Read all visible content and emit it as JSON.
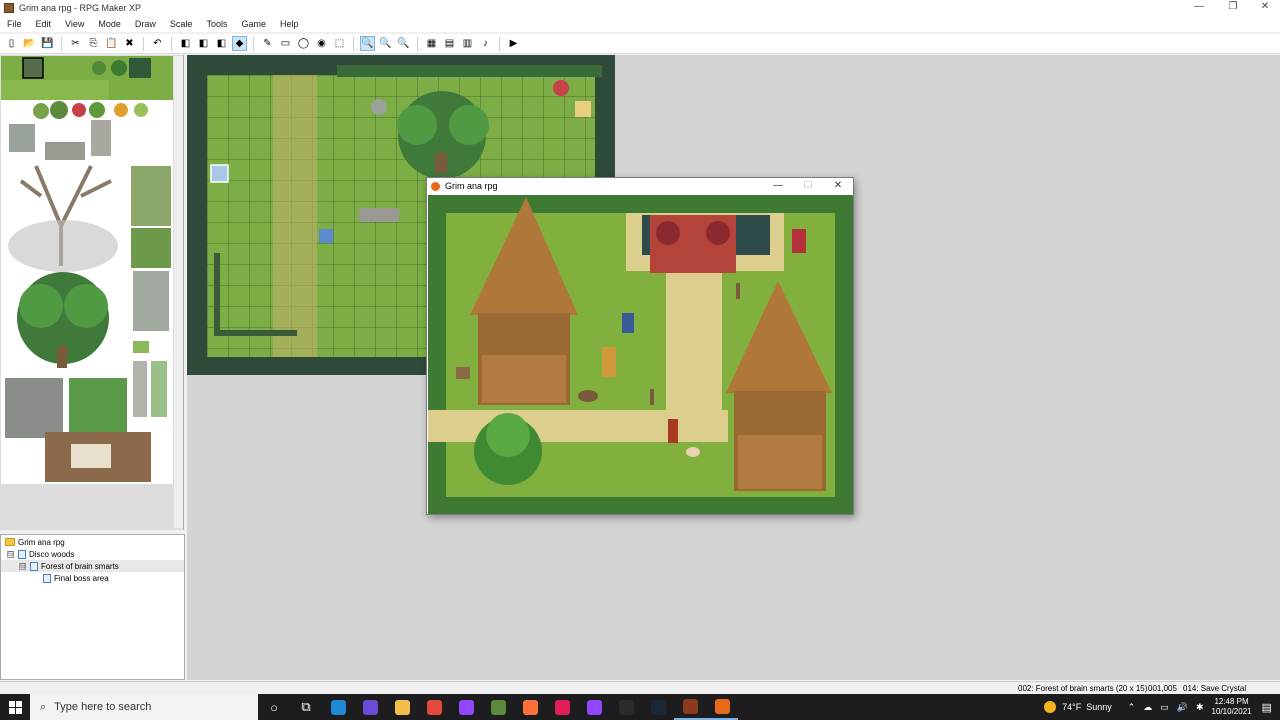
{
  "window": {
    "title": "Grim ana rpg - RPG Maker XP",
    "minimize": "—",
    "maximize": "❐",
    "close": "✕"
  },
  "menu": [
    "File",
    "Edit",
    "View",
    "Mode",
    "Draw",
    "Scale",
    "Tools",
    "Game",
    "Help"
  ],
  "toolbar": [
    {
      "icon": "new-icon",
      "glyph": "▯"
    },
    {
      "icon": "open-icon",
      "glyph": "📂"
    },
    {
      "icon": "save-icon",
      "glyph": "💾"
    },
    {
      "icon": "cut-icon",
      "glyph": "✂"
    },
    {
      "icon": "copy-icon",
      "glyph": "⎘"
    },
    {
      "icon": "paste-icon",
      "glyph": "📋"
    },
    {
      "icon": "delete-icon",
      "glyph": "✖"
    },
    {
      "icon": "undo-icon",
      "glyph": "↶"
    },
    {
      "icon": "layer1-icon",
      "glyph": "◧"
    },
    {
      "icon": "layer2-icon",
      "glyph": "◧"
    },
    {
      "icon": "layer3-icon",
      "glyph": "◧"
    },
    {
      "icon": "events-layer-icon",
      "glyph": "◆",
      "active": true
    },
    {
      "icon": "pencil-icon",
      "glyph": "✎"
    },
    {
      "icon": "rectangle-icon",
      "glyph": "▭"
    },
    {
      "icon": "ellipse-icon",
      "glyph": "◯"
    },
    {
      "icon": "fill-icon",
      "glyph": "◉"
    },
    {
      "icon": "select-icon",
      "glyph": "⬚"
    },
    {
      "icon": "zoom-1-icon",
      "glyph": "🔍",
      "active": true
    },
    {
      "icon": "zoom-2-icon",
      "glyph": "🔍"
    },
    {
      "icon": "zoom-4-icon",
      "glyph": "🔍"
    },
    {
      "icon": "database-icon",
      "glyph": "▦"
    },
    {
      "icon": "materials-icon",
      "glyph": "▤"
    },
    {
      "icon": "script-editor-icon",
      "glyph": "▥"
    },
    {
      "icon": "sound-test-icon",
      "glyph": "♪"
    },
    {
      "icon": "playtest-icon",
      "glyph": "▶"
    }
  ],
  "maptree": {
    "project": "Grim ana rpg",
    "items": [
      {
        "label": "Disco woods",
        "expander": "⊟"
      },
      {
        "label": "Forest of brain smarts",
        "expander": "⊟",
        "selected": true
      },
      {
        "label": "Final boss area"
      }
    ]
  },
  "gamewindow": {
    "title": "Grim ana rpg",
    "minimize": "—",
    "maximize": "☐",
    "close": "✕"
  },
  "statusbar": {
    "map": "002: Forest of brain smarts (20 x 15)",
    "coords": "001,005",
    "event": "014: Save Crystal"
  },
  "taskbar": {
    "search_placeholder": "Type here to search",
    "apps": [
      {
        "icon": "cortana-icon",
        "color": "#1d1d1f",
        "glyph": "○"
      },
      {
        "icon": "task-view-icon",
        "color": "#1d1d1f",
        "glyph": "⧉"
      },
      {
        "icon": "edge-icon",
        "color": "#1e88d2"
      },
      {
        "icon": "app-purple-icon",
        "color": "#6b4bd8"
      },
      {
        "icon": "file-explorer-icon",
        "color": "#f2c04a"
      },
      {
        "icon": "chrome-icon",
        "color": "#e24a3b"
      },
      {
        "icon": "twitch-alt-icon",
        "color": "#9146ff"
      },
      {
        "icon": "minecraft-icon",
        "color": "#5a8a3a"
      },
      {
        "icon": "firefox-icon",
        "color": "#ff7139"
      },
      {
        "icon": "slack-icon",
        "color": "#e01e5a"
      },
      {
        "icon": "twitch-icon",
        "color": "#9146ff"
      },
      {
        "icon": "notepad-icon",
        "color": "#2b2b2b"
      },
      {
        "icon": "steam-icon",
        "color": "#1b2838"
      },
      {
        "icon": "rpgmaker-icon",
        "color": "#8b3a1a",
        "running": true
      },
      {
        "icon": "game-icon",
        "color": "#e8681c",
        "running": true
      }
    ],
    "weather_temp": "74°F",
    "weather_text": "Sunny",
    "time": "12:48 PM",
    "date": "10/10/2021"
  }
}
